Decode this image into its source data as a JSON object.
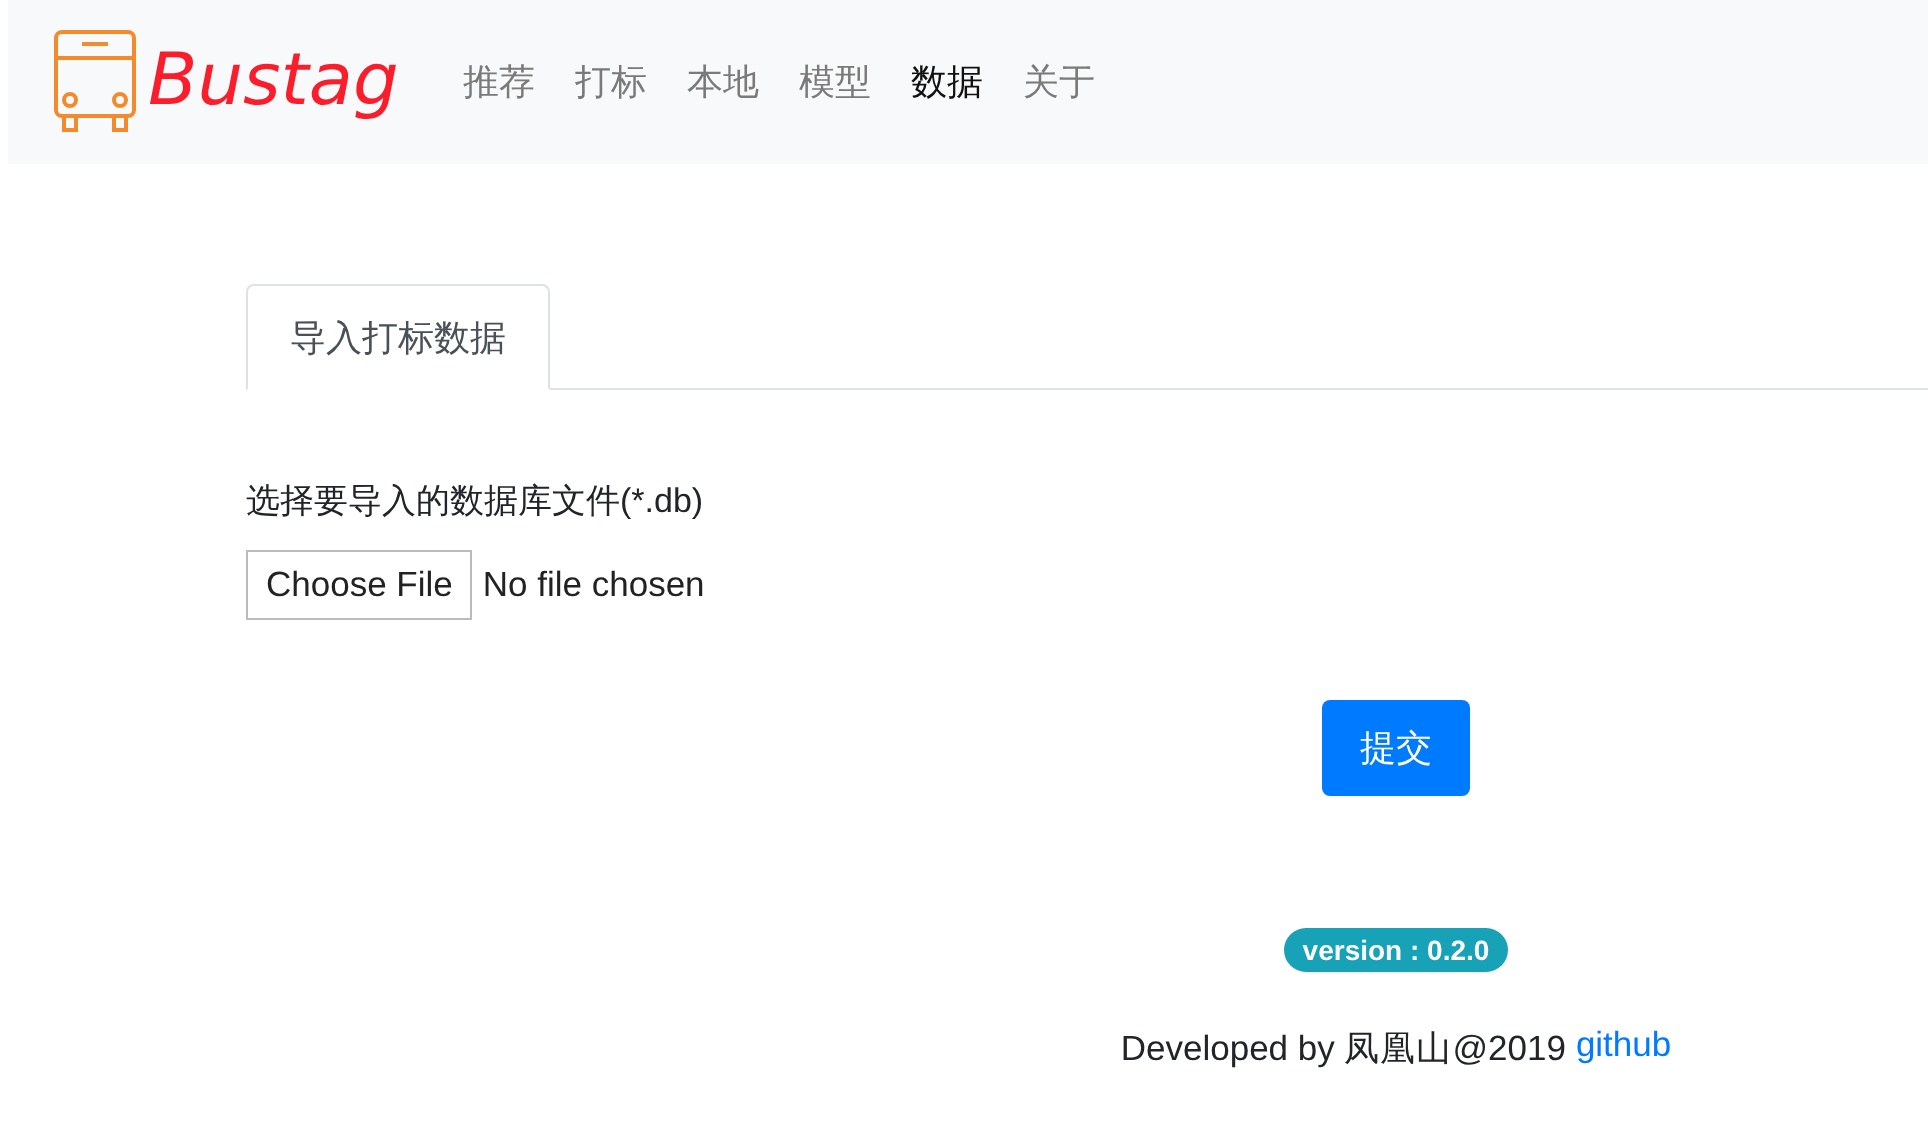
{
  "brand": {
    "name": "Bustag"
  },
  "nav": [
    {
      "label": "推荐",
      "selected": false
    },
    {
      "label": "打标",
      "selected": false
    },
    {
      "label": "本地",
      "selected": false
    },
    {
      "label": "模型",
      "selected": false
    },
    {
      "label": "数据",
      "selected": true
    },
    {
      "label": "关于",
      "selected": false
    }
  ],
  "tabs": [
    {
      "label": "导入打标数据",
      "selected": true
    }
  ],
  "form": {
    "label": "选择要导入的数据库文件(*.db)",
    "file_button": "Choose File",
    "file_status": "No file chosen",
    "submit": "提交"
  },
  "footer": {
    "version": "version : 0.2.0",
    "credit": "Developed by 凤凰山@2019",
    "link": "github"
  }
}
